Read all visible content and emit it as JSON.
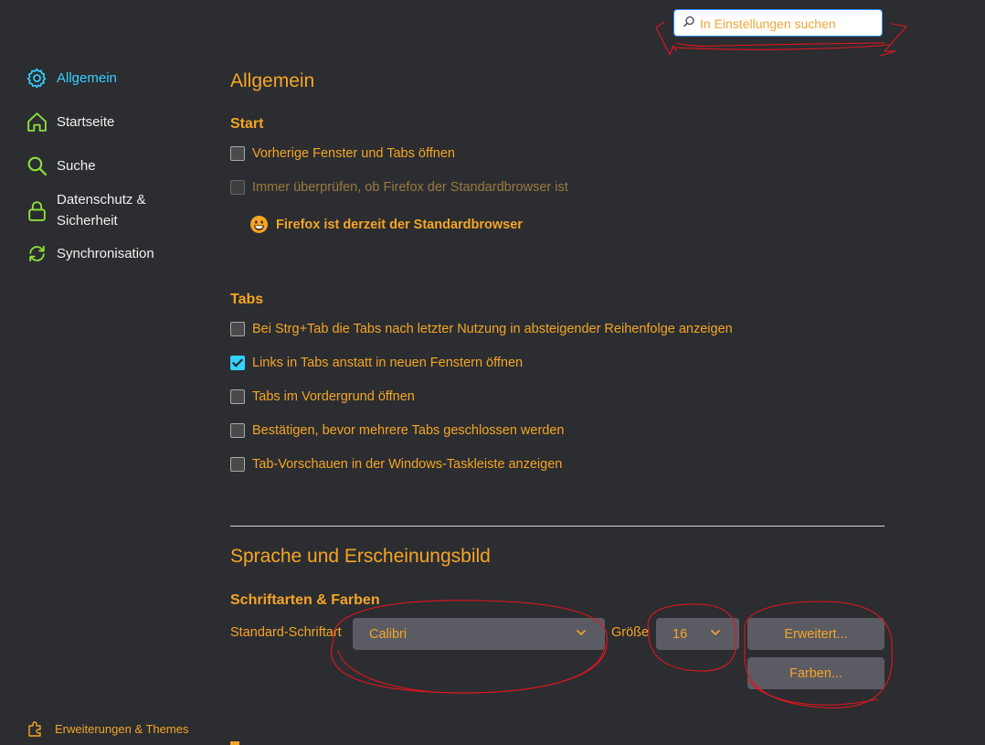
{
  "search": {
    "placeholder": "In Einstellungen suchen",
    "value": ""
  },
  "sidebar": {
    "items": [
      {
        "label": "Allgemein",
        "icon": "gear-icon",
        "active": true
      },
      {
        "label": "Startseite",
        "icon": "home-icon"
      },
      {
        "label": "Suche",
        "icon": "search-icon"
      },
      {
        "label": "Datenschutz & Sicherheit",
        "line1": "Datenschutz &",
        "line2": "Sicherheit",
        "icon": "lock-icon"
      },
      {
        "label": "Synchronisation",
        "icon": "sync-icon"
      }
    ],
    "footer_link": "Erweiterungen & Themes"
  },
  "main": {
    "title": "Allgemein",
    "start": {
      "heading": "Start",
      "options": [
        {
          "label": "Vorherige Fenster und Tabs öffnen",
          "checked": false
        },
        {
          "label": "Immer überprüfen, ob Firefox der Standardbrowser ist",
          "checked": false,
          "disabled": true
        }
      ],
      "default_browser_status": "Firefox ist derzeit der Standardbrowser"
    },
    "tabs": {
      "heading": "Tabs",
      "options": [
        {
          "label": "Bei Strg+Tab die Tabs nach letzter Nutzung in absteigender Reihenfolge anzeigen",
          "checked": false
        },
        {
          "label": "Links in Tabs anstatt in neuen Fenstern öffnen",
          "checked": true
        },
        {
          "label": "Tabs im Vordergrund öffnen",
          "checked": false
        },
        {
          "label": "Bestätigen, bevor mehrere Tabs geschlossen werden",
          "checked": false
        },
        {
          "label": "Tab-Vorschauen in der Windows-Taskleiste anzeigen",
          "checked": false
        }
      ]
    },
    "language": {
      "title": "Sprache und Erscheinungsbild",
      "fonts_heading": "Schriftarten & Farben",
      "font_label": "Standard-Schriftart",
      "font_value": "Calibri",
      "size_label": "Größe",
      "size_value": "16",
      "advanced_button": "Erweitert...",
      "colors_button": "Farben..."
    }
  },
  "colors": {
    "background": "#2b2d31",
    "text_accent": "#f5a524",
    "active_nav": "#35d1ff",
    "icon_green": "#8fe03a",
    "annotation_red": "#e0161c"
  }
}
